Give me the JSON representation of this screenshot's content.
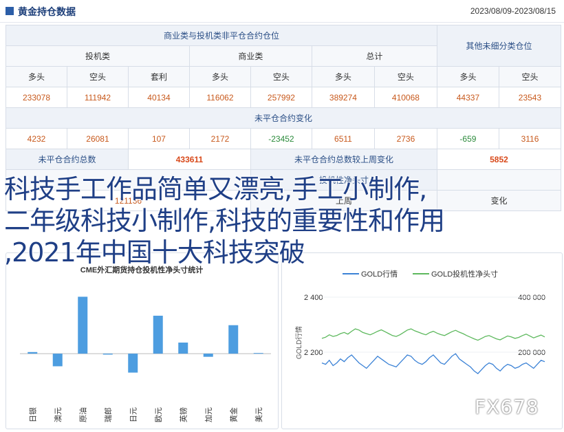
{
  "header": {
    "title": "黄金持仓数据",
    "date_range": "2023/08/09-2023/08/15"
  },
  "table": {
    "commercial_title": "商业类与投机类非平仓合约仓位",
    "other_title": "其他未细分类仓位",
    "groups": [
      "投机类",
      "商业类",
      "总计"
    ],
    "subheads": [
      "多头",
      "空头",
      "套利",
      "多头",
      "空头",
      "多头",
      "空头",
      "多头",
      "空头"
    ],
    "positions": [
      "233078",
      "111942",
      "40134",
      "116062",
      "257992",
      "389274",
      "410068",
      "44337",
      "23543"
    ],
    "change_title": "未平仓合约变化",
    "changes": [
      "4232",
      "26081",
      "107",
      "2172",
      "-23452",
      "6511",
      "2736",
      "-659",
      "3116"
    ],
    "total_label": "未平仓合约总数",
    "total_value": "433611",
    "week_change_label": "未平仓合约总数较上周变化",
    "week_change_value": "5852",
    "row5_left": "",
    "row5_mid": "投机性净头寸",
    "row6_mid": "上周",
    "row6_right": "变化",
    "row6_left_value": "121136"
  },
  "overlay_text": [
    "科技手工作品简单又漂亮,手工小制作,",
    "二年级科技小制作,科技的重要性和作用",
    ",2021年中国十大科技突破"
  ],
  "watermark": "FX678",
  "colors": {
    "bar": "#4d9de0",
    "gold_line": "#3b82d6",
    "position_line": "#5cb85c"
  },
  "left_chart": {
    "title": "CME外汇期货持仓投机性净头寸统计",
    "chart_data": {
      "type": "bar",
      "categories": [
        "日银",
        "澳元",
        "原油",
        "瑞郎",
        "日元",
        "欧元",
        "英镑",
        "加元",
        "黄金",
        "美元"
      ],
      "values": [
        0.5,
        -4,
        18,
        -0.3,
        -6,
        12,
        3.5,
        -1,
        9,
        0.2
      ],
      "ylim": [
        -15,
        22
      ]
    }
  },
  "right_chart": {
    "legend": [
      "GOLD行情",
      "GOLD投机性净头寸"
    ],
    "ylabel_left": "GOLD行情",
    "y_left_ticks": [
      "2 400",
      "2 200"
    ],
    "y_right_ticks": [
      "400 000",
      "200 000"
    ],
    "chart_data": {
      "type": "line",
      "series": [
        {
          "name": "GOLD行情",
          "values": [
            2180,
            2175,
            2190,
            2170,
            2180,
            2195,
            2185,
            2200,
            2210,
            2195,
            2180,
            2170,
            2160,
            2175,
            2190,
            2205,
            2195,
            2185,
            2175,
            2170,
            2165,
            2180,
            2195,
            2210,
            2205,
            2190,
            2180,
            2175,
            2185,
            2200,
            2210,
            2195,
            2180,
            2175,
            2190,
            2205,
            2215,
            2195,
            2185,
            2175,
            2165,
            2150,
            2140,
            2155,
            2170,
            2180,
            2175,
            2160,
            2150,
            2165,
            2175,
            2170,
            2160,
            2165,
            2175,
            2180,
            2170,
            2160,
            2175,
            2190,
            2185
          ]
        },
        {
          "name": "GOLD投机性净头寸",
          "values": [
            250000,
            255000,
            265000,
            258000,
            262000,
            270000,
            275000,
            268000,
            280000,
            290000,
            285000,
            275000,
            270000,
            265000,
            272000,
            280000,
            286000,
            278000,
            270000,
            262000,
            258000,
            265000,
            275000,
            285000,
            290000,
            282000,
            276000,
            270000,
            265000,
            274000,
            280000,
            272000,
            266000,
            262000,
            270000,
            278000,
            284000,
            276000,
            270000,
            262000,
            255000,
            248000,
            242000,
            250000,
            258000,
            262000,
            255000,
            248000,
            244000,
            252000,
            260000,
            256000,
            250000,
            254000,
            262000,
            268000,
            260000,
            252000,
            258000,
            264000,
            256000
          ]
        }
      ],
      "ylim_left": [
        2050,
        2450
      ],
      "ylim_right": [
        0,
        450000
      ]
    }
  }
}
